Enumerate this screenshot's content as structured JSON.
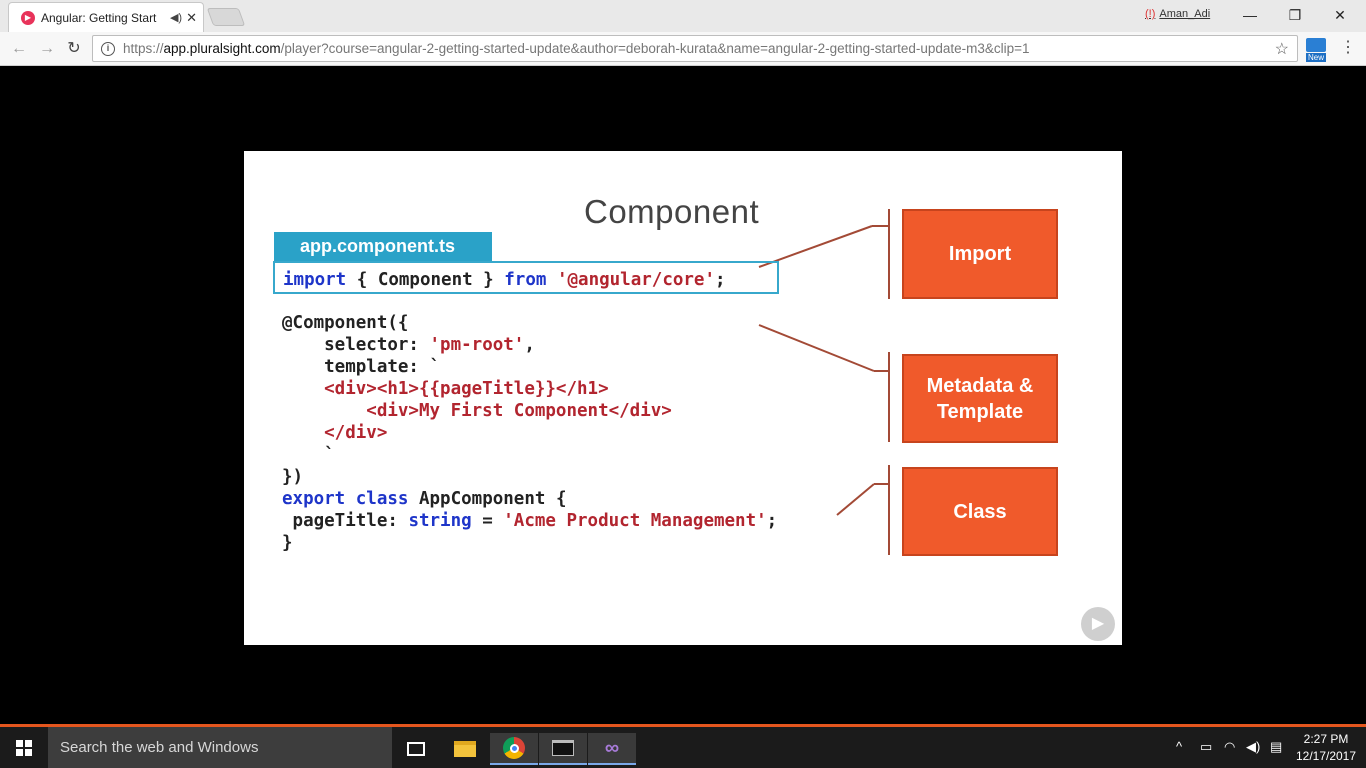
{
  "browser": {
    "tab": {
      "title": "Angular: Getting Start",
      "favicon_color": "#e8335a",
      "audio_icon": "speaker-icon",
      "close_icon": "close-icon"
    },
    "profile_name": "Aman_Adi",
    "window_controls": {
      "minimize": "—",
      "restore": "❐",
      "close": "✕"
    },
    "address": {
      "scheme": "https://",
      "host": "app.pluralsight.com",
      "path": "/player?course=angular-2-getting-started-update&author=deborah-kurata&name=angular-2-getting-started-update-m3&clip=1"
    },
    "extension_label": "New"
  },
  "slide": {
    "title": "Component",
    "file_name": "app.component.ts",
    "code": {
      "import_line": {
        "kw1": "import",
        "mid": " { Component } ",
        "kw2": "from",
        "sp": " ",
        "str": "'@angular/core'",
        "end": ";"
      },
      "decorator": "@Component({",
      "selector_key": "    selector: ",
      "selector_val": "'pm-root'",
      "selector_end": ",",
      "template_key": "    template: `",
      "tpl_line1": "    <div><h1>{{pageTitle}}</h1>",
      "tpl_line2": "        <div>My First Component</div>",
      "tpl_line3": "    </div>",
      "tpl_close": "    `",
      "decorator_end": "})",
      "export_kw": "export class",
      "class_name": " AppComponent {",
      "prop_name": " pageTitle: ",
      "prop_type": "string",
      "prop_eq": " = ",
      "prop_val": "'Acme Product Management'",
      "prop_end": ";",
      "close_brace": "}"
    },
    "callouts": {
      "import": "Import",
      "metadata_l1": "Metadata &",
      "metadata_l2": "Template",
      "class": "Class"
    },
    "callout_color": "#f05a2b",
    "tab_color": "#2aa2c8",
    "keyword_color": "#1e35c9",
    "string_color": "#b2252f"
  },
  "taskbar": {
    "search_placeholder": "Search the web and Windows",
    "time": "2:27 PM",
    "date": "12/17/2017",
    "accent": "#e4561e"
  }
}
